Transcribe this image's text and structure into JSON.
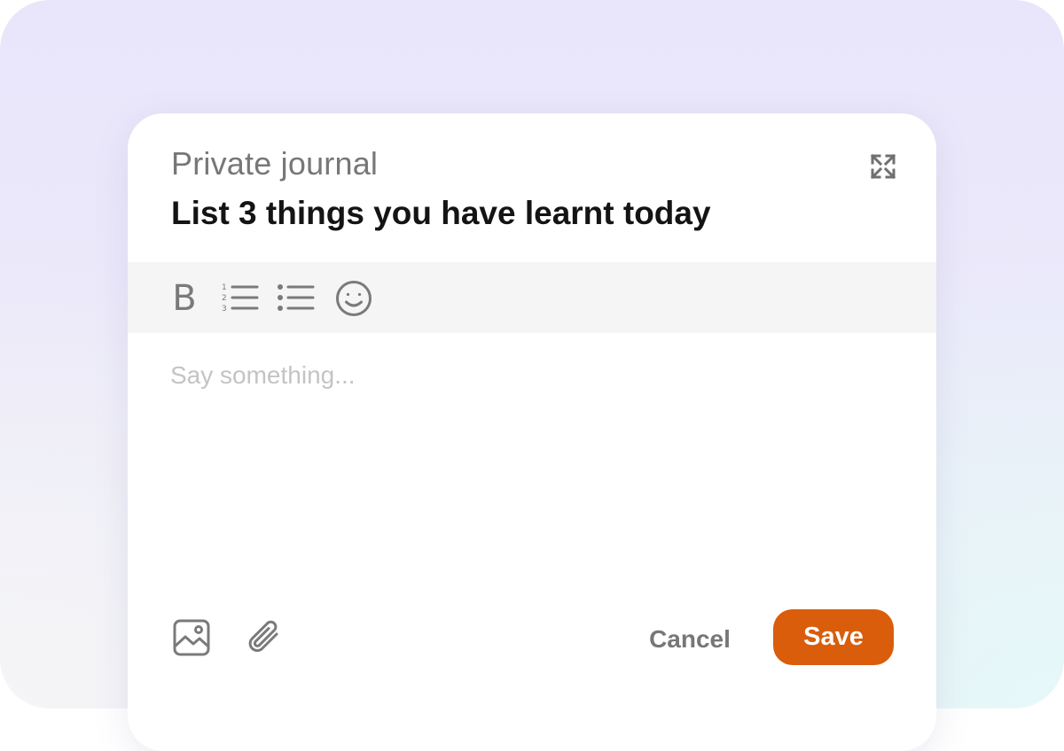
{
  "journal": {
    "kicker": "Private journal",
    "title": "List 3 things you have learnt today"
  },
  "header": {
    "expand_icon": "expand-arrows-icon"
  },
  "toolbar": {
    "bold_label": "B",
    "items": [
      {
        "name": "bold",
        "icon": "bold-icon"
      },
      {
        "name": "numbered-list",
        "icon": "numbered-list-icon"
      },
      {
        "name": "bulleted-list",
        "icon": "bulleted-list-icon"
      },
      {
        "name": "emoji",
        "icon": "smiley-icon"
      }
    ]
  },
  "editor": {
    "placeholder": "Say something...",
    "value": ""
  },
  "footer": {
    "image_icon": "image-icon",
    "attach_icon": "paperclip-icon",
    "cancel_label": "Cancel",
    "save_label": "Save"
  },
  "colors": {
    "accent": "#d95d0a",
    "title": "#141414",
    "muted": "#777777",
    "toolbar_bg": "#f5f5f5",
    "icon": "#7a7a7a",
    "placeholder": "#c4c4c4",
    "backdrop_top": "#e9e6fb",
    "backdrop_bottom_right": "#e5f8f9"
  }
}
